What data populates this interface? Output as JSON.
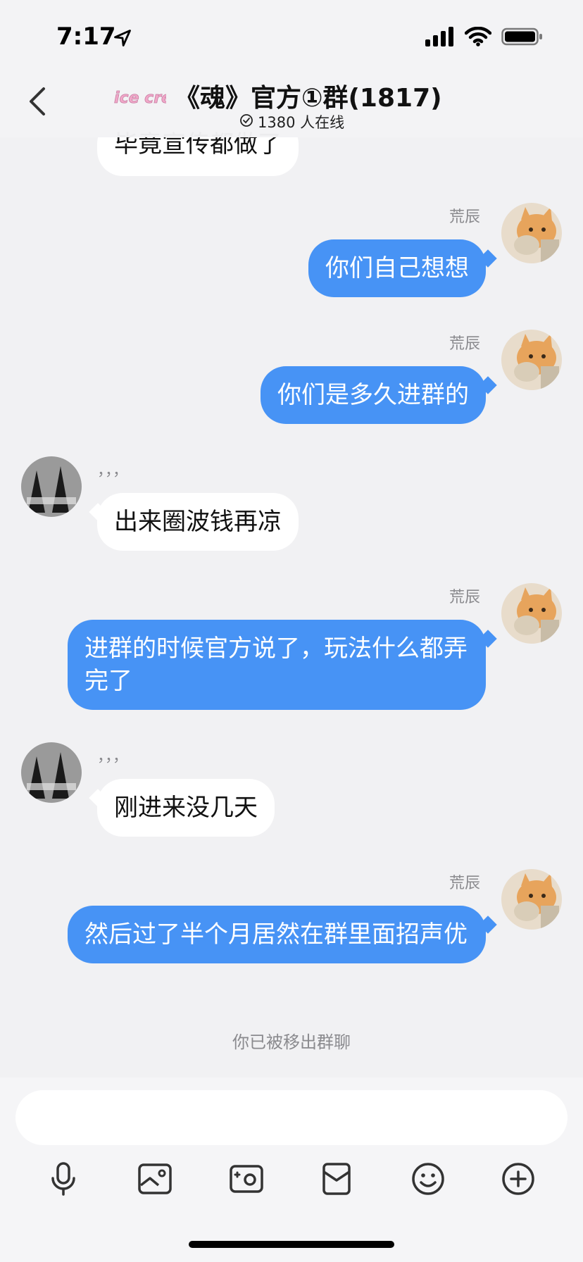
{
  "status": {
    "time": "7:17"
  },
  "header": {
    "title": "《魂》官方①群(1817)",
    "online": "1380 人在线",
    "logo_text": "ice cream"
  },
  "messages": [
    {
      "side": "in",
      "text": "毕竟宣传都做了",
      "partial": true
    },
    {
      "side": "out",
      "sender": "荒辰",
      "text": "你们自己想想"
    },
    {
      "side": "out",
      "sender": "荒辰",
      "text": "你们是多久进群的"
    },
    {
      "side": "in",
      "sender": "，，，",
      "text": "出来圈波钱再凉"
    },
    {
      "side": "out",
      "sender": "荒辰",
      "text": "进群的时候官方说了，玩法什么都弄完了"
    },
    {
      "side": "in",
      "sender": "，，，",
      "text": "刚进来没几天"
    },
    {
      "side": "out",
      "sender": "荒辰",
      "text": "然后过了半个月居然在群里面招声优"
    }
  ],
  "system_note": "你已被移出群聊",
  "composer": {
    "icons": [
      "microphone-icon",
      "image-icon",
      "camera-icon",
      "red-packet-icon",
      "emoji-icon",
      "plus-icon"
    ]
  },
  "colors": {
    "outgoing_bubble": "#4793f5",
    "incoming_bubble": "#ffffff",
    "background": "#f1f1f3"
  }
}
